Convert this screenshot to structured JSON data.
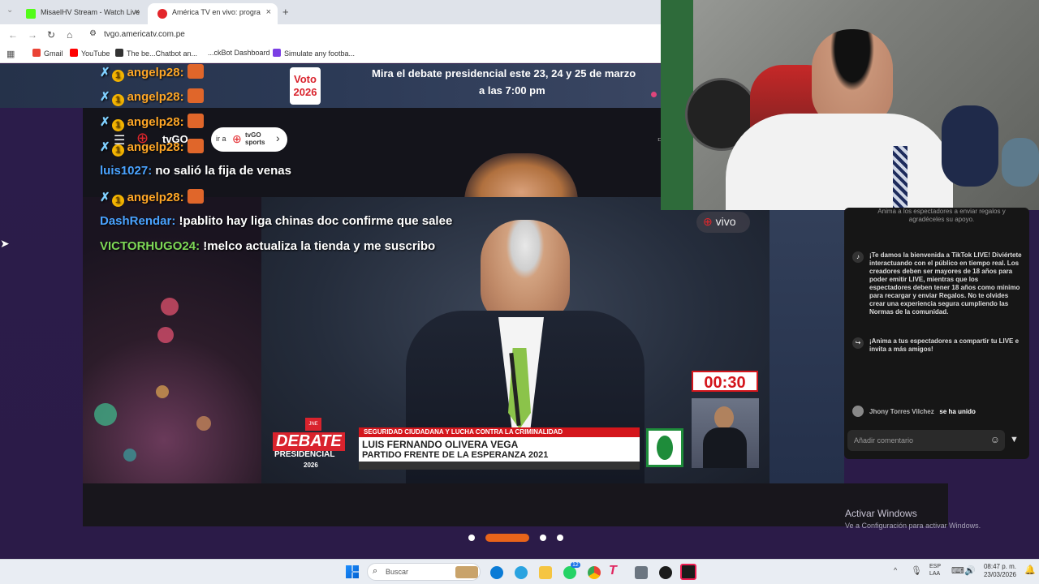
{
  "browser": {
    "tabs": [
      {
        "label": "MisaelHV Stream - Watch Live",
        "close": "×"
      },
      {
        "label": "América TV en vivo: progra",
        "close": "×"
      }
    ],
    "new_tab": "+",
    "url": "tvgo.americatv.com.pe",
    "bookmarks": [
      "Gmail",
      "YouTube",
      "The be...Chatbot an...",
      "...ckBot Dashboard",
      "Simulate any footba..."
    ]
  },
  "banner": {
    "badge": "Voto\n2026",
    "line1": "Mira el debate presidencial este 23, 24 y 25 de marzo",
    "line2": "a las 7:00 pm"
  },
  "tvgo": {
    "logo": "tvGO",
    "link": "ir a",
    "sports": "tvGO sports",
    "chevron": "›"
  },
  "chat": [
    {
      "user": "angelp28:",
      "msg": ""
    },
    {
      "user": "angelp28:",
      "msg": ""
    },
    {
      "user": "angelp28:",
      "msg": ""
    },
    {
      "user": "angelp28:",
      "msg": ""
    },
    {
      "user": "luis1027:",
      "msg": "no salió la fija de venas"
    },
    {
      "user": "angelp28:",
      "msg": ""
    },
    {
      "user": "DashRendar:",
      "msg": "!pablito hay liga chinas doc confirme que salee"
    },
    {
      "user": "VICTORHUGO24:",
      "msg": "!melco actualiza la tienda y me suscribo"
    }
  ],
  "video": {
    "live_badge": "vivo",
    "timer": "00:30",
    "lower_third_topic": "SEGURIDAD CIUDADANA Y LUCHA CONTRA LA CRIMINALIDAD",
    "lower_third_name": "LUIS FERNANDO OLIVERA VEGA",
    "lower_third_party": "PARTIDO FRENTE DE LA ESPERANZA 2021",
    "debate_logo_line1": "DEBATE",
    "debate_logo_line2": "PRESIDENCIAL",
    "debate_logo_year": "2026",
    "jne": "JNE"
  },
  "tiktok": {
    "top_text": "Anima a los espectadores a enviar regalos y agradéceles su apoyo.",
    "welcome": "¡Te damos la bienvenida a TikTok LIVE! Diviértete interactuando con el público en tiempo real. Los creadores deben ser mayores de 18 años para poder emitir LIVE, mientras que los espectadores deben tener 18 años como mínimo para recargar y enviar Regalos. No te olvides crear una experiencia segura cumpliendo las Normas de la comunidad.",
    "share": "¡Anima a tus espectadores a compartir tu LIVE e invita a más amigos!",
    "joined_user": "Jhony Torres Vilchez",
    "joined_text": "se ha unido",
    "comment_placeholder": "Añadir comentario"
  },
  "carousel": {
    "active_index": 1,
    "count": 4
  },
  "activate_windows": {
    "title": "Activar Windows",
    "subtitle": "Ve a Configuración para activar Windows."
  },
  "taskbar": {
    "search": "Buscar",
    "lang1": "ESP",
    "lang2": "LAA",
    "time": "08:47 p. m.",
    "date": "23/03/2026",
    "whatsapp_badge": "12"
  },
  "colors": {
    "page_bg": "#2b1c4a",
    "carousel_active": "#e8641a",
    "timer_red": "#d4161c",
    "user_angel": "#ffa726",
    "user_luis": "#4aa3ff",
    "user_dash": "#4aa3ff",
    "user_victor": "#7ed957"
  }
}
